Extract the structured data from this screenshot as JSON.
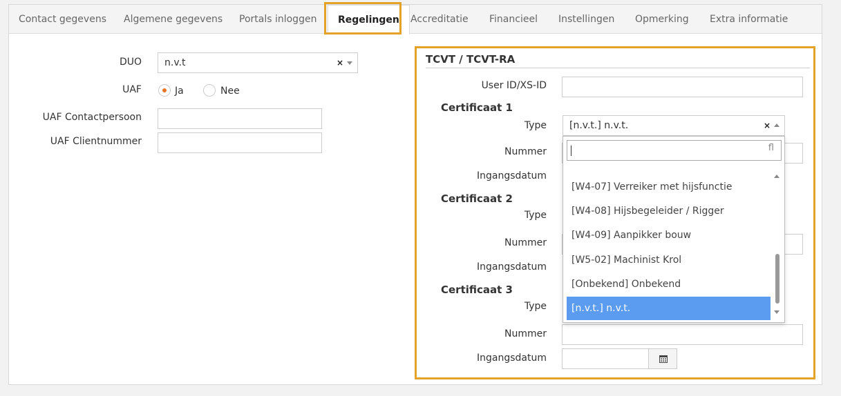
{
  "tabs": [
    {
      "label": "Contact gegevens"
    },
    {
      "label": "Algemene gegevens"
    },
    {
      "label": "Portals inloggen"
    },
    {
      "label": "Regelingen"
    },
    {
      "label": "Accreditatie"
    },
    {
      "label": "Financieel"
    },
    {
      "label": "Instellingen"
    },
    {
      "label": "Opmerking"
    },
    {
      "label": "Extra informatie"
    }
  ],
  "left": {
    "duo_label": "DUO",
    "duo_value": "n.v.t",
    "uaf_label": "UAF",
    "uaf_options": [
      "Ja",
      "Nee"
    ],
    "uaf_selected": "Ja",
    "contact_label": "UAF Contactpersoon",
    "contact_value": "",
    "client_label": "UAF Clientnummer",
    "client_value": ""
  },
  "tcvt": {
    "title": "TCVT / TCVT-RA",
    "userid_label": "User ID/XS-ID",
    "userid_value": "",
    "certificates": [
      {
        "heading": "Certificaat 1",
        "type_label": "Type",
        "type_value": "[n.v.t.] n.v.t.",
        "nummer_label": "Nummer",
        "datum_label": "Ingangsdatum"
      },
      {
        "heading": "Certificaat 2",
        "type_label": "Type",
        "nummer_label": "Nummer",
        "datum_label": "Ingangsdatum"
      },
      {
        "heading": "Certificaat 3",
        "type_label": "Type",
        "nummer_label": "Nummer",
        "datum_label": "Ingangsdatum"
      }
    ]
  },
  "dropdown": {
    "search_value": "",
    "options": [
      "[W4-07] Verreiker met hijsfunctie",
      "[W4-08] Hijsbegeleider / Rigger",
      "[W4-09] Aanpikker bouw",
      "[W5-02] Machinist Krol",
      "[Onbekend] Onbekend",
      "[n.v.t.] n.v.t."
    ],
    "selected": "[n.v.t.] n.v.t."
  },
  "colors": {
    "highlight": "#e5a229",
    "selected_option": "#5b9cf0",
    "radio_dot": "#e8742b"
  },
  "icons": {
    "search": "search-icon",
    "calendar": "calendar-icon",
    "clear": "clear-icon"
  }
}
